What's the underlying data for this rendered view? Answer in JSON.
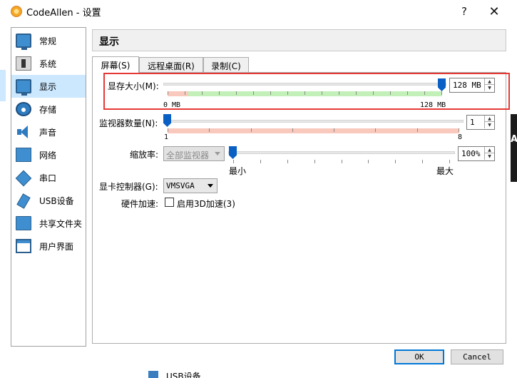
{
  "window": {
    "title": "CodeAllen - 设置",
    "help": "?",
    "close": "✕"
  },
  "sidebar": {
    "items": [
      {
        "label": "常规",
        "icon": "monitor-icon"
      },
      {
        "label": "系统",
        "icon": "chip-icon"
      },
      {
        "label": "显示",
        "icon": "display-icon"
      },
      {
        "label": "存储",
        "icon": "disk-icon"
      },
      {
        "label": "声音",
        "icon": "speaker-icon"
      },
      {
        "label": "网络",
        "icon": "network-icon"
      },
      {
        "label": "串口",
        "icon": "serial-port-icon"
      },
      {
        "label": "USB设备",
        "icon": "usb-icon"
      },
      {
        "label": "共享文件夹",
        "icon": "folder-icon"
      },
      {
        "label": "用户界面",
        "icon": "window-icon"
      }
    ],
    "active_index": 2
  },
  "page": {
    "title": "显示"
  },
  "tabs": [
    "屏幕(S)",
    "远程桌面(R)",
    "录制(C)"
  ],
  "screen": {
    "video_memory": {
      "label": "显存大小(M):",
      "value": "128 MB",
      "min_label": "0 MB",
      "max_label": "128 MB",
      "level": 1.0
    },
    "monitors": {
      "label": "监视器数量(N):",
      "value": "1",
      "min_label": "1",
      "max_label": "8",
      "level": 0.0
    },
    "scale": {
      "label": "缩放率:",
      "combo": "全部监视器",
      "value": "100%",
      "min_label": "最小",
      "max_label": "最大",
      "level": 0.0
    },
    "graphics_controller": {
      "label": "显卡控制器(G):",
      "value": "VMSVGA"
    },
    "acceleration": {
      "label": "硬件加速:",
      "checkbox_label": "启用3D加速(3)",
      "checked": false
    }
  },
  "buttons": {
    "ok": "OK",
    "cancel": "Cancel"
  },
  "background": {
    "right_letter": "A",
    "bottom_text": "USB设备"
  },
  "colors": {
    "accent": "#0a5fc4",
    "highlight_border": "#e53935",
    "good_zone": "#c3f0b8",
    "bad_zone": "#f9c9bd"
  }
}
